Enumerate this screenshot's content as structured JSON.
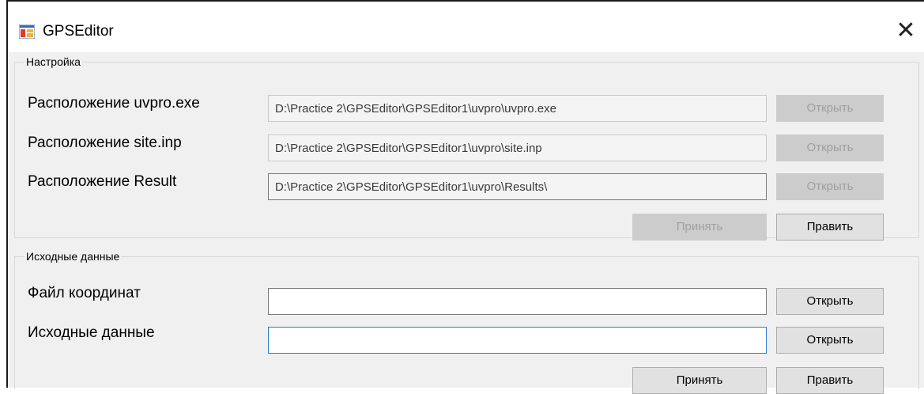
{
  "window": {
    "title": "GPSEditor",
    "close_glyph": "✕"
  },
  "settings": {
    "legend": "Настройка",
    "rows": [
      {
        "label": "Расположение uvpro.exe",
        "value": "D:\\Practice 2\\GPSEditor\\GPSEditor1\\uvpro\\uvpro.exe",
        "button": "Открыть"
      },
      {
        "label": "Расположение site.inp",
        "value": "D:\\Practice 2\\GPSEditor\\GPSEditor1\\uvpro\\site.inp",
        "button": "Открыть"
      },
      {
        "label": "Расположение Result",
        "value": "D:\\Practice 2\\GPSEditor\\GPSEditor1\\uvpro\\Results\\",
        "button": "Открыть"
      }
    ],
    "accept_label": "Принять",
    "edit_label": "Править"
  },
  "source": {
    "legend": "Исходные данные",
    "rows": [
      {
        "label": "Файл координат",
        "value": "",
        "button": "Открыть"
      },
      {
        "label": "Исходные данные",
        "value": "",
        "button": "Открыть"
      }
    ],
    "accept_label": "Принять",
    "edit_label": "Править"
  },
  "icons": {
    "app": "app-window-icon",
    "close": "close-icon"
  },
  "colors": {
    "window_bg": "#f0f0f0",
    "focus_border": "#2b78d6",
    "disabled_button": "#cccccc"
  }
}
